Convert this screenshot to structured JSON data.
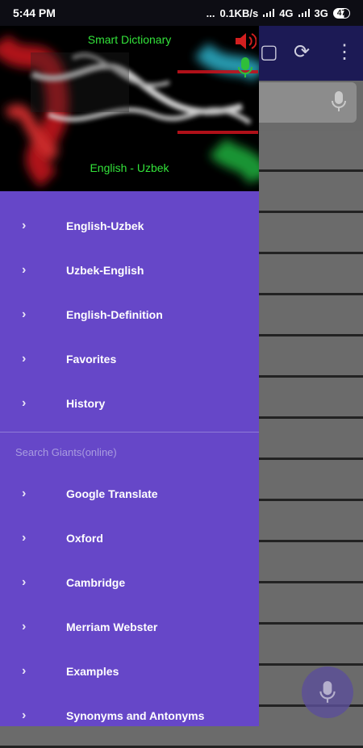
{
  "status_bar": {
    "time": "5:44 PM",
    "dots": "...",
    "speed": "0.1KB/s",
    "net1": "4G",
    "net2": "3G",
    "battery": "47"
  },
  "drawer": {
    "header": {
      "title": "Smart Dictionary",
      "subtitle": "English - Uzbek"
    },
    "items": [
      {
        "label": "English-Uzbek"
      },
      {
        "label": "Uzbek-English"
      },
      {
        "label": "English-Definition"
      },
      {
        "label": "Favorites"
      },
      {
        "label": "History"
      }
    ],
    "section_title": "Search Giants(online)",
    "online_items": [
      {
        "label": "Google Translate"
      },
      {
        "label": "Oxford"
      },
      {
        "label": "Cambridge"
      },
      {
        "label": "Merriam Webster"
      },
      {
        "label": "Examples"
      },
      {
        "label": "Synonyms and Antonyms"
      }
    ]
  },
  "colors": {
    "drawer_bg": "#6647c8",
    "header_text": "#33e33a",
    "toolbar": "#1c1a55"
  }
}
